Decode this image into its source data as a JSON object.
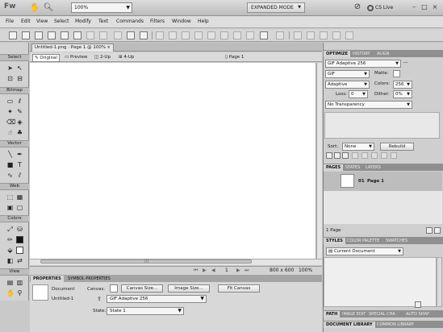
{
  "app": {
    "logo": "Fw",
    "zoom": "100%",
    "mode": "EXPANDED MODE",
    "cs_live": "CS Live"
  },
  "menu": [
    "File",
    "Edit",
    "View",
    "Select",
    "Modify",
    "Text",
    "Commands",
    "Filters",
    "Window",
    "Help"
  ],
  "tools": {
    "sections": [
      "Select",
      "Bitmap",
      "Vector",
      "Web",
      "Colors",
      "View"
    ]
  },
  "document": {
    "tab_title": "Untitled-1.png : Page 1 @ 100%",
    "views": [
      "Original",
      "Preview",
      "2-Up",
      "4-Up"
    ],
    "page_label": "Page 1",
    "status": {
      "page": "1",
      "size": "800 x 600",
      "zoom": "100%"
    }
  },
  "properties": {
    "tabs": [
      "PROPERTIES",
      "SYMBOL PROPERTIES"
    ],
    "doc_label": "Document",
    "doc_name": "Untitled-1",
    "canvas_label": "Canvas:",
    "canvas_size_btn": "Canvas Size...",
    "image_size_btn": "Image Size...",
    "fit_canvas_btn": "Fit Canvas",
    "format": "GIF Adaptive 256",
    "state_label": "State:",
    "state_value": "State 1"
  },
  "optimize": {
    "tabs": [
      "OPTIMIZE",
      "HISTORY",
      "ALIGN"
    ],
    "preset": "GIF Adaptive 256",
    "format": "GIF",
    "matte_label": "Matte:",
    "palette": "Adaptive",
    "colors_label": "Colors:",
    "colors_value": "256",
    "loss_label": "Loss:",
    "loss_value": "0",
    "dither_label": "Dither:",
    "dither_value": "0%",
    "transparency": "No Transparency",
    "sort_label": "Sort:",
    "sort_value": "None",
    "rebuild_label": "Rebuild"
  },
  "pages": {
    "tabs": [
      "PAGES",
      "STATES",
      "LAYERS"
    ],
    "items": [
      {
        "num": "01",
        "name": "Page 1"
      }
    ],
    "footer": "1 Page"
  },
  "styles": {
    "tabs": [
      "STYLES",
      "COLOR PALETTE",
      "SWATCHES"
    ],
    "source": "Current Document"
  },
  "path": {
    "tabs": [
      "PATH",
      "IMAGE EDIT",
      "SPECIAL CHA",
      "AUTO SHAP"
    ]
  },
  "library": {
    "tabs": [
      "DOCUMENT LIBRARY",
      "COMMON LIBRARY"
    ]
  }
}
